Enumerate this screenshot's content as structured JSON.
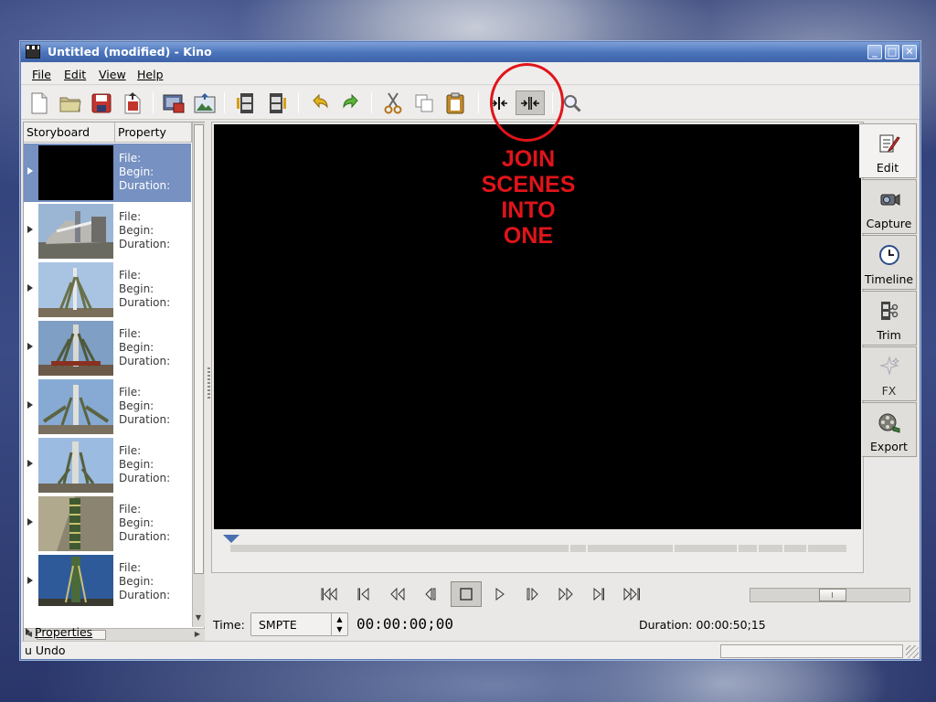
{
  "window": {
    "title": "Untitled (modified) - Kino"
  },
  "menu": {
    "items": [
      {
        "label": "File"
      },
      {
        "label": "Edit"
      },
      {
        "label": "View"
      },
      {
        "label": "Help"
      }
    ]
  },
  "toolbar": {
    "buttons": [
      {
        "icon": "new-document-icon"
      },
      {
        "icon": "open-folder-icon"
      },
      {
        "icon": "save-icon"
      },
      {
        "icon": "save-as-icon"
      },
      {
        "icon": "save-frame-icon"
      },
      {
        "icon": "export-image-icon"
      },
      {
        "icon": "insert-before-icon"
      },
      {
        "icon": "insert-after-icon"
      },
      {
        "icon": "undo-icon"
      },
      {
        "icon": "redo-icon"
      },
      {
        "icon": "cut-icon"
      },
      {
        "icon": "copy-icon"
      },
      {
        "icon": "paste-icon"
      },
      {
        "icon": "split-scene-icon"
      },
      {
        "icon": "join-scenes-icon",
        "active": true
      },
      {
        "icon": "magnify-icon"
      }
    ]
  },
  "annotation": {
    "lines": [
      "JOIN",
      "SCENES",
      "INTO",
      "ONE"
    ],
    "color": "#e0141a"
  },
  "storyboard": {
    "columns": [
      "Storyboard",
      "Property"
    ],
    "scenes": [
      {
        "file": "File:",
        "begin": "Begin:",
        "duration": "Duration:",
        "selected": true
      },
      {
        "file": "File:",
        "begin": "Begin:",
        "duration": "Duration:"
      },
      {
        "file": "File:",
        "begin": "Begin:",
        "duration": "Duration:"
      },
      {
        "file": "File:",
        "begin": "Begin:",
        "duration": "Duration:"
      },
      {
        "file": "File:",
        "begin": "Begin:",
        "duration": "Duration:"
      },
      {
        "file": "File:",
        "begin": "Begin:",
        "duration": "Duration:"
      },
      {
        "file": "File:",
        "begin": "Begin:",
        "duration": "Duration:"
      },
      {
        "file": "File:",
        "begin": "Begin:",
        "duration": "Duration:"
      }
    ],
    "properties_label": "Properties"
  },
  "mode_tabs": [
    {
      "label": "Edit",
      "icon": "edit-icon",
      "active": true
    },
    {
      "label": "Capture",
      "icon": "camcorder-icon"
    },
    {
      "label": "Timeline",
      "icon": "clock-icon"
    },
    {
      "label": "Trim",
      "icon": "trim-icon"
    },
    {
      "label": "FX",
      "icon": "sparkle-icon",
      "disabled": true
    },
    {
      "label": "Export",
      "icon": "film-reel-icon"
    }
  ],
  "transport": {
    "buttons": [
      {
        "icon": "first-scene-icon"
      },
      {
        "icon": "previous-scene-icon"
      },
      {
        "icon": "rewind-icon"
      },
      {
        "icon": "step-back-icon"
      },
      {
        "icon": "stop-icon",
        "active": true
      },
      {
        "icon": "play-icon"
      },
      {
        "icon": "step-forward-icon"
      },
      {
        "icon": "fast-forward-icon"
      },
      {
        "icon": "next-scene-icon"
      },
      {
        "icon": "last-scene-icon"
      }
    ]
  },
  "time": {
    "label": "Time:",
    "format": "SMPTE",
    "timecode": "00:00:00;00",
    "duration": "Duration: 00:00:50;15"
  },
  "playhead_fraction": 0.0,
  "zoom_slider_fraction": 0.52,
  "status": {
    "text": "u  Undo"
  },
  "colors": {
    "titlebar": "#4a73ba",
    "selection": "#7691c2",
    "video_background": "#000000"
  }
}
